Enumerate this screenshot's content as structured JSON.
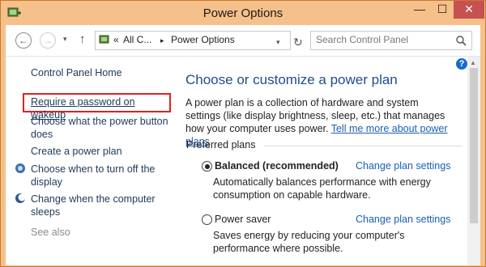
{
  "window": {
    "title": "Power Options",
    "controls": {
      "minimize": "—",
      "maximize": "☐",
      "close": "✕"
    }
  },
  "navbar": {
    "back_icon": "arrow-left-icon",
    "forward_icon": "arrow-right-icon",
    "up_icon": "arrow-up-icon",
    "address": {
      "prefix": "«",
      "crumb1": "All C...",
      "separator": "▸",
      "crumb2": "Power Options"
    },
    "search": {
      "placeholder": "Search Control Panel"
    }
  },
  "sidebar": {
    "items": [
      {
        "label": "Control Panel Home"
      },
      {
        "label": "Require a password on wakeup"
      },
      {
        "label": "Choose what the power button does"
      },
      {
        "label": "Create a power plan"
      },
      {
        "label": "Choose when to turn off the display"
      },
      {
        "label": "Change when the computer sleeps"
      }
    ],
    "see_also": "See also"
  },
  "main": {
    "heading": "Choose or customize a power plan",
    "description": "A power plan is a collection of hardware and system settings (like display brightness, sleep, etc.) that manages how your computer uses power.",
    "learn_more": "Tell me more about power plans",
    "preferred_label": "Preferred plans",
    "plans": [
      {
        "name": "Balanced (recommended)",
        "selected": true,
        "change": "Change plan settings",
        "desc": "Automatically balances performance with energy consumption on capable hardware."
      },
      {
        "name": "Power saver",
        "selected": false,
        "change": "Change plan settings",
        "desc": "Saves energy by reducing your computer's performance where possible."
      }
    ]
  },
  "colors": {
    "frame": "#f6c08a",
    "link": "#1a5fb4",
    "heading": "#1e4d8c",
    "highlight": "#e02020"
  }
}
